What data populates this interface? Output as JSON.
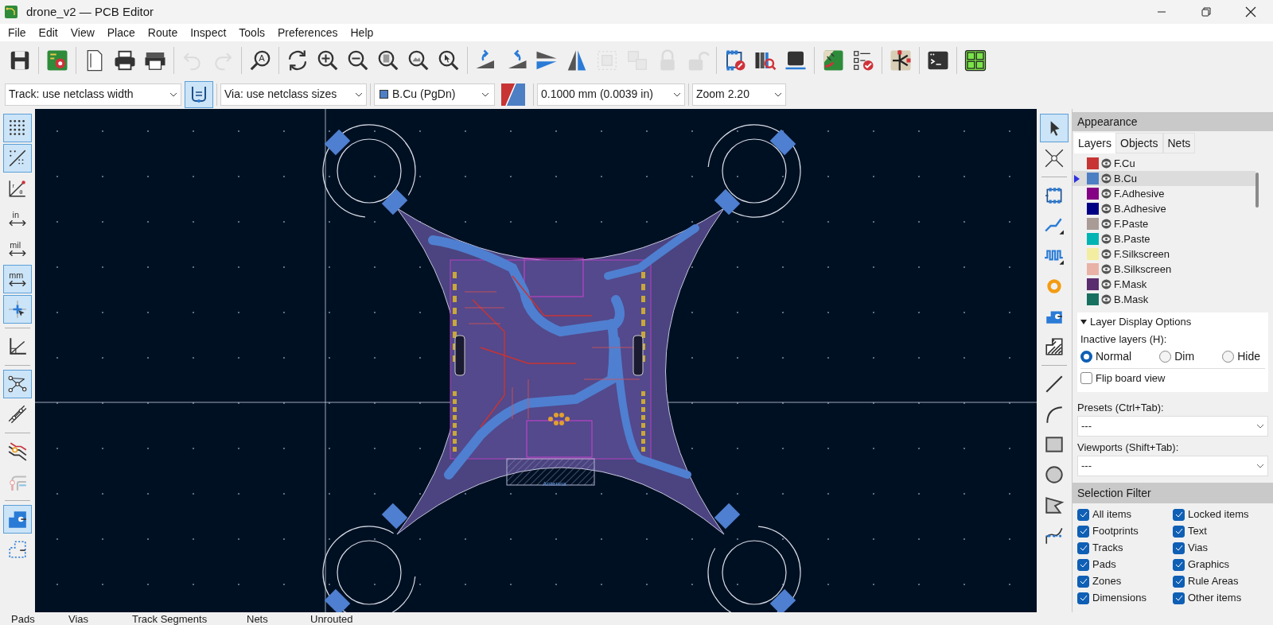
{
  "window": {
    "title": "drone_v2 — PCB Editor"
  },
  "menu": [
    "File",
    "Edit",
    "View",
    "Place",
    "Route",
    "Inspect",
    "Tools",
    "Preferences",
    "Help"
  ],
  "top_toolbar": [
    {
      "kind": "save",
      "disabled": false
    },
    {
      "kind": "separator"
    },
    {
      "kind": "board-setup",
      "disabled": false
    },
    {
      "kind": "separator"
    },
    {
      "kind": "page",
      "disabled": false
    },
    {
      "kind": "print",
      "disabled": false
    },
    {
      "kind": "plot",
      "disabled": false
    },
    {
      "kind": "separator"
    },
    {
      "kind": "undo",
      "disabled": true
    },
    {
      "kind": "redo",
      "disabled": true
    },
    {
      "kind": "separator"
    },
    {
      "kind": "find",
      "disabled": false,
      "labels": [
        "A"
      ]
    },
    {
      "kind": "separator"
    },
    {
      "kind": "redraw",
      "disabled": false
    },
    {
      "kind": "zoom-in",
      "disabled": false
    },
    {
      "kind": "zoom-out",
      "disabled": false
    },
    {
      "kind": "zoom-fit",
      "disabled": false
    },
    {
      "kind": "zoom-objects",
      "disabled": false
    },
    {
      "kind": "zoom-selection",
      "disabled": false
    },
    {
      "kind": "separator"
    },
    {
      "kind": "rotate-ccw",
      "disabled": false
    },
    {
      "kind": "rotate-cw",
      "disabled": false
    },
    {
      "kind": "flip",
      "disabled": false
    },
    {
      "kind": "mirror",
      "disabled": false
    },
    {
      "kind": "group",
      "disabled": true
    },
    {
      "kind": "ungroup",
      "disabled": true
    },
    {
      "kind": "lock",
      "disabled": true
    },
    {
      "kind": "unlock",
      "disabled": true
    },
    {
      "kind": "separator"
    },
    {
      "kind": "footprint-editor",
      "disabled": false
    },
    {
      "kind": "library",
      "disabled": false
    },
    {
      "kind": "chip",
      "disabled": false
    },
    {
      "kind": "separator"
    },
    {
      "kind": "board-update",
      "disabled": false
    },
    {
      "kind": "checklist",
      "disabled": false
    },
    {
      "kind": "separator"
    },
    {
      "kind": "schematic",
      "disabled": false
    },
    {
      "kind": "separator"
    },
    {
      "kind": "console",
      "disabled": false
    },
    {
      "kind": "separator"
    },
    {
      "kind": "front-back",
      "disabled": false
    }
  ],
  "second_toolbar": {
    "track_width": "Track: use netclass width",
    "auto_width": {
      "selected": true
    },
    "via_size": "Via: use netclass sizes",
    "layer": {
      "label": "B.Cu (PgDn)",
      "color": "#4d7fc4"
    },
    "grid": "0.1000 mm (0.0039 in)",
    "zoom": "Zoom 2.20"
  },
  "left_toolbar": [
    {
      "kind": "grid",
      "selected": true
    },
    {
      "kind": "grid-override",
      "selected": true
    },
    {
      "kind": "polar",
      "selected": false,
      "labels": [
        "r",
        "θ"
      ]
    },
    {
      "kind": "inches",
      "selected": false,
      "labels": [
        "in"
      ]
    },
    {
      "kind": "mils",
      "selected": false,
      "labels": [
        "mil"
      ]
    },
    {
      "kind": "millimeters",
      "selected": true,
      "labels": [
        "mm"
      ]
    },
    {
      "kind": "full-cursor",
      "selected": true
    },
    {
      "kind": "separator"
    },
    {
      "kind": "axes",
      "selected": false
    },
    {
      "kind": "separator"
    },
    {
      "kind": "ratsnest",
      "selected": true
    },
    {
      "kind": "curved-ratsnest",
      "selected": false
    },
    {
      "kind": "separator"
    },
    {
      "kind": "net-highlight",
      "selected": false
    },
    {
      "kind": "track-display",
      "selected": false
    },
    {
      "kind": "separator"
    },
    {
      "kind": "zone-fill",
      "selected": true
    },
    {
      "kind": "zone-outline",
      "selected": false
    }
  ],
  "right_toolbar": [
    {
      "kind": "select",
      "selected": true
    },
    {
      "kind": "local-ratsnest",
      "selected": false
    },
    {
      "kind": "separator"
    },
    {
      "kind": "footprint",
      "selected": false
    },
    {
      "kind": "route",
      "selected": false
    },
    {
      "kind": "tune",
      "selected": false
    },
    {
      "kind": "via",
      "selected": false
    },
    {
      "kind": "zone",
      "selected": false
    },
    {
      "kind": "rule-area",
      "selected": false
    },
    {
      "kind": "separator"
    },
    {
      "kind": "line",
      "selected": false
    },
    {
      "kind": "arc",
      "selected": false
    },
    {
      "kind": "rectangle",
      "selected": false
    },
    {
      "kind": "circle",
      "selected": false
    },
    {
      "kind": "polygon",
      "selected": false
    },
    {
      "kind": "bezier",
      "selected": false
    }
  ],
  "canvas": {
    "antenna_label": "Antenna"
  },
  "appearance": {
    "title": "Appearance",
    "tabs": [
      {
        "label": "Layers",
        "selected": true
      },
      {
        "label": "Objects",
        "selected": false
      },
      {
        "label": "Nets",
        "selected": false
      }
    ],
    "layers": [
      {
        "name": "F.Cu",
        "color": "#c83434",
        "visible": true,
        "selected": false
      },
      {
        "name": "B.Cu",
        "color": "#4d7fc4",
        "visible": true,
        "selected": true
      },
      {
        "name": "F.Adhesive",
        "color": "#840084",
        "visible": true,
        "selected": false
      },
      {
        "name": "B.Adhesive",
        "color": "#000084",
        "visible": true,
        "selected": false
      },
      {
        "name": "F.Paste",
        "color": "#a99b96",
        "visible": true,
        "selected": false
      },
      {
        "name": "B.Paste",
        "color": "#00b4b4",
        "visible": true,
        "selected": false
      },
      {
        "name": "F.Silkscreen",
        "color": "#f2eda1",
        "visible": true,
        "selected": false
      },
      {
        "name": "B.Silkscreen",
        "color": "#e8b2a7",
        "visible": true,
        "selected": false
      },
      {
        "name": "F.Mask",
        "color": "#5a2d6e",
        "visible": true,
        "selected": false
      },
      {
        "name": "B.Mask",
        "color": "#17705f",
        "visible": true,
        "selected": false
      }
    ],
    "display_options": {
      "title": "Layer Display Options",
      "expanded": true,
      "inactive_label": "Inactive layers (H):",
      "inactive_modes": [
        {
          "label": "Normal",
          "selected": true
        },
        {
          "label": "Dim",
          "selected": false
        },
        {
          "label": "Hide",
          "selected": false
        }
      ],
      "flip_board": {
        "label": "Flip board view",
        "checked": false
      }
    },
    "presets_label": "Presets (Ctrl+Tab):",
    "presets_value": "---",
    "viewports_label": "Viewports (Shift+Tab):",
    "viewports_value": "---"
  },
  "selection_filter": {
    "title": "Selection Filter",
    "items": [
      {
        "label": "All items",
        "checked": true
      },
      {
        "label": "Locked items",
        "checked": true
      },
      {
        "label": "Footprints",
        "checked": true
      },
      {
        "label": "Text",
        "checked": true
      },
      {
        "label": "Tracks",
        "checked": true
      },
      {
        "label": "Vias",
        "checked": true
      },
      {
        "label": "Pads",
        "checked": true
      },
      {
        "label": "Graphics",
        "checked": true
      },
      {
        "label": "Zones",
        "checked": true
      },
      {
        "label": "Rule Areas",
        "checked": true
      },
      {
        "label": "Dimensions",
        "checked": true
      },
      {
        "label": "Other items",
        "checked": true
      }
    ]
  },
  "status_bar": [
    "Pads",
    "Vias",
    "Track Segments",
    "Nets",
    "Unrouted"
  ]
}
